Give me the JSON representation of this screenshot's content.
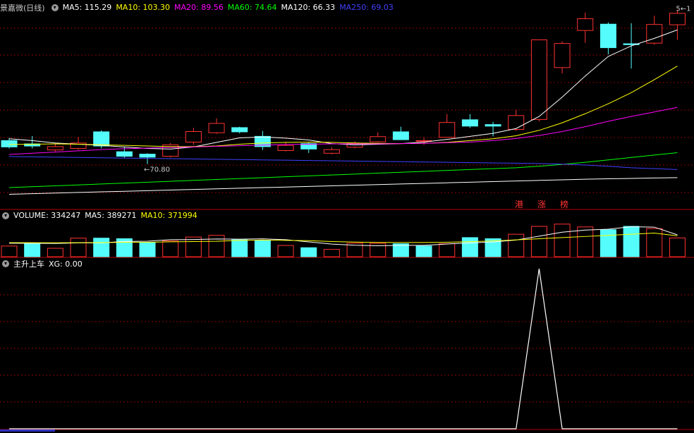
{
  "panels": {
    "price": {
      "title": "景嘉微(日线)",
      "indicators": [
        {
          "label": "MA5: 115.29",
          "color": "#ffffff"
        },
        {
          "label": "MA10: 103.30",
          "color": "#ffff00"
        },
        {
          "label": "MA20: 89.56",
          "color": "#ff00ff"
        },
        {
          "label": "MA60: 74.64",
          "color": "#00ff00"
        },
        {
          "label": "MA120: 66.33",
          "color": "#ffffff"
        },
        {
          "label": "MA250: 69.03",
          "color": "#4040ff"
        }
      ],
      "low_label": "←70.80",
      "high_label": "5←1",
      "tags": [
        "港",
        "涨",
        "榜"
      ]
    },
    "volume": {
      "indicators": [
        {
          "label": "VOLUME: 334247",
          "color": "#ffffff"
        },
        {
          "label": "MA5: 389271",
          "color": "#ffffff"
        },
        {
          "label": "MA10: 371994",
          "color": "#ffff00"
        }
      ]
    },
    "signal": {
      "indicators": [
        {
          "label": "主升上车",
          "color": "#ffffff"
        },
        {
          "label": "XG: 0.00",
          "color": "#ffffff"
        }
      ]
    }
  },
  "colors": {
    "up": "#ff3232",
    "down": "#54fcfc",
    "grid": "#8b0000"
  },
  "chart_data": [
    {
      "type": "candlestick",
      "ylim": [
        56,
        121
      ],
      "candles": [
        {
          "o": 78.6,
          "c": 76.5,
          "h": 79.5,
          "l": 76.0
        },
        {
          "o": 77.5,
          "c": 76.8,
          "h": 80.1,
          "l": 76.0
        },
        {
          "o": 75.5,
          "c": 76.6,
          "h": 77.6,
          "l": 75.0
        },
        {
          "o": 76.0,
          "c": 77.8,
          "h": 79.8,
          "l": 75.5
        },
        {
          "o": 81.5,
          "c": 76.8,
          "h": 82.0,
          "l": 76.0
        },
        {
          "o": 74.9,
          "c": 73.4,
          "h": 76.5,
          "l": 72.8
        },
        {
          "o": 74.1,
          "c": 73.1,
          "h": 74.4,
          "l": 70.8
        },
        {
          "o": 73.4,
          "c": 77.2,
          "h": 77.8,
          "l": 73.0
        },
        {
          "o": 78.1,
          "c": 81.6,
          "h": 82.8,
          "l": 77.2
        },
        {
          "o": 81.2,
          "c": 84.3,
          "h": 86.0,
          "l": 80.8
        },
        {
          "o": 82.9,
          "c": 81.5,
          "h": 83.2,
          "l": 81.0
        },
        {
          "o": 80.0,
          "c": 76.6,
          "h": 81.8,
          "l": 75.5
        },
        {
          "o": 75.3,
          "c": 77.0,
          "h": 78.0,
          "l": 75.0
        },
        {
          "o": 77.6,
          "c": 75.8,
          "h": 78.0,
          "l": 74.5
        },
        {
          "o": 74.4,
          "c": 75.6,
          "h": 76.3,
          "l": 74.0
        },
        {
          "o": 76.4,
          "c": 77.7,
          "h": 78.4,
          "l": 76.0
        },
        {
          "o": 78.2,
          "c": 79.9,
          "h": 81.3,
          "l": 78.0
        },
        {
          "o": 81.5,
          "c": 78.9,
          "h": 83.2,
          "l": 78.8
        },
        {
          "o": 78.6,
          "c": 78.6,
          "h": 79.5,
          "l": 77.2
        },
        {
          "o": 79.7,
          "c": 84.6,
          "h": 87.4,
          "l": 79.6
        },
        {
          "o": 85.5,
          "c": 83.4,
          "h": 87.4,
          "l": 82.8
        },
        {
          "o": 83.9,
          "c": 83.4,
          "h": 84.8,
          "l": 80.0
        },
        {
          "o": 82.3,
          "c": 86.9,
          "h": 88.8,
          "l": 81.8
        },
        {
          "o": 85.6,
          "c": 112.0,
          "h": 112.0,
          "l": 85.0
        },
        {
          "o": 102.8,
          "c": 110.8,
          "h": 111.5,
          "l": 100.8
        },
        {
          "o": 115.1,
          "c": 119.0,
          "h": 121.0,
          "l": 111.0
        },
        {
          "o": 117.2,
          "c": 109.4,
          "h": 117.8,
          "l": 107.2
        },
        {
          "o": 110.7,
          "c": 110.4,
          "h": 117.5,
          "l": 102.5
        },
        {
          "o": 110.9,
          "c": 117.1,
          "h": 120.0,
          "l": 110.4
        },
        {
          "o": 117.0,
          "c": 120.8,
          "h": 122.0,
          "l": 112.0
        }
      ],
      "ma": [
        {
          "name": "MA5",
          "color": "#ffffff",
          "values": [
            79.2,
            78.6,
            77.8,
            77.4,
            77.0,
            76.5,
            76.0,
            75.8,
            76.5,
            78.0,
            79.5,
            79.8,
            79.4,
            78.8,
            77.6,
            77.2,
            77.4,
            77.6,
            78.1,
            79.0,
            80.0,
            81.0,
            82.6,
            86.6,
            93.0,
            100.0,
            106.5,
            110.0,
            112.5,
            115.3
          ],
          "color_key": "#ffffff"
        },
        {
          "name": "MA10",
          "color": "#ffff00",
          "values": [
            77.3,
            77.4,
            77.5,
            77.4,
            77.2,
            77.0,
            76.8,
            76.6,
            76.6,
            76.8,
            77.4,
            77.8,
            78.0,
            78.1,
            78.0,
            77.8,
            77.7,
            77.6,
            77.7,
            78.0,
            78.6,
            79.2,
            80.2,
            82.0,
            84.5,
            87.5,
            90.8,
            94.5,
            98.8,
            103.3
          ]
        },
        {
          "name": "MA20",
          "color": "#ff00ff",
          "values": [
            74.0,
            74.4,
            74.8,
            75.2,
            75.6,
            75.9,
            76.1,
            76.3,
            76.5,
            76.7,
            76.9,
            77.1,
            77.3,
            77.4,
            77.5,
            77.5,
            77.5,
            77.6,
            77.7,
            77.9,
            78.1,
            78.6,
            79.3,
            80.3,
            81.6,
            83.2,
            85.0,
            86.6,
            88.1,
            89.6
          ]
        },
        {
          "name": "MA60",
          "color": "#00ff00",
          "values": [
            63.0,
            63.3,
            63.6,
            63.9,
            64.2,
            64.5,
            64.8,
            65.1,
            65.4,
            65.7,
            66.0,
            66.3,
            66.6,
            66.9,
            67.2,
            67.5,
            67.8,
            68.1,
            68.4,
            68.7,
            69.0,
            69.3,
            69.6,
            70.1,
            70.7,
            71.4,
            72.2,
            73.0,
            73.8,
            74.6
          ]
        },
        {
          "name": "MA120",
          "color": "#ffffff",
          "values": [
            60.8,
            61.0,
            61.2,
            61.4,
            61.6,
            61.8,
            62.0,
            62.2,
            62.4,
            62.6,
            62.8,
            63.0,
            63.2,
            63.4,
            63.6,
            63.8,
            64.0,
            64.2,
            64.4,
            64.6,
            64.8,
            65.0,
            65.2,
            65.4,
            65.6,
            65.8,
            65.95,
            66.05,
            66.2,
            66.33
          ]
        },
        {
          "name": "MA250",
          "color": "#4040ff",
          "values": [
            73.3,
            73.2,
            73.1,
            73.0,
            72.9,
            72.8,
            72.7,
            72.6,
            72.5,
            72.4,
            72.3,
            72.2,
            72.1,
            72.0,
            71.9,
            71.8,
            71.7,
            71.6,
            71.5,
            71.4,
            71.3,
            71.2,
            71.1,
            71.0,
            70.8,
            70.5,
            70.1,
            69.6,
            69.3,
            69.0
          ]
        }
      ]
    },
    {
      "type": "bar",
      "ylim": [
        0,
        640000
      ],
      "values": [
        190000,
        230000,
        150000,
        330000,
        330000,
        320000,
        250000,
        280000,
        350000,
        380000,
        300000,
        290000,
        200000,
        160000,
        130000,
        240000,
        240000,
        230000,
        190000,
        230000,
        340000,
        320000,
        400000,
        540000,
        580000,
        530000,
        480000,
        540000,
        500000,
        334247
      ],
      "up": [
        true,
        false,
        true,
        true,
        false,
        false,
        false,
        true,
        true,
        true,
        false,
        false,
        true,
        false,
        true,
        true,
        true,
        false,
        false,
        true,
        false,
        false,
        true,
        true,
        true,
        true,
        false,
        false,
        true,
        true
      ],
      "ma": [
        {
          "name": "MA5",
          "color": "#ffffff",
          "values": [
            240000,
            238000,
            236000,
            246000,
            246000,
            272000,
            276000,
            302000,
            306000,
            316000,
            312000,
            318000,
            302000,
            264000,
            224000,
            204000,
            194000,
            202000,
            202000,
            226000,
            246000,
            262000,
            296000,
            366000,
            436000,
            474000,
            490000,
            534000,
            526000,
            389271
          ]
        },
        {
          "name": "MA10",
          "color": "#ffff00",
          "values": [
            250000,
            249000,
            248000,
            250000,
            251000,
            255000,
            258000,
            265000,
            270000,
            275000,
            290000,
            297000,
            290000,
            285000,
            270000,
            260000,
            253000,
            252000,
            253000,
            257000,
            268000,
            280000,
            300000,
            320000,
            340000,
            360000,
            380000,
            400000,
            420000,
            371994
          ]
        }
      ]
    },
    {
      "type": "line",
      "ylim": [
        0,
        1
      ],
      "x": [
        0,
        1,
        2,
        3,
        4,
        5,
        6,
        7,
        8,
        9,
        10,
        11,
        12,
        13,
        14,
        15,
        16,
        17,
        18,
        19,
        20,
        21,
        22,
        23,
        24,
        25,
        26,
        27,
        28,
        29
      ],
      "values": [
        0,
        0,
        0,
        0,
        0,
        0,
        0,
        0,
        0,
        0,
        0,
        0,
        0,
        0,
        0,
        0,
        0,
        0,
        0,
        0,
        0,
        0,
        0,
        1,
        0,
        0,
        0,
        0,
        0,
        0
      ]
    }
  ]
}
